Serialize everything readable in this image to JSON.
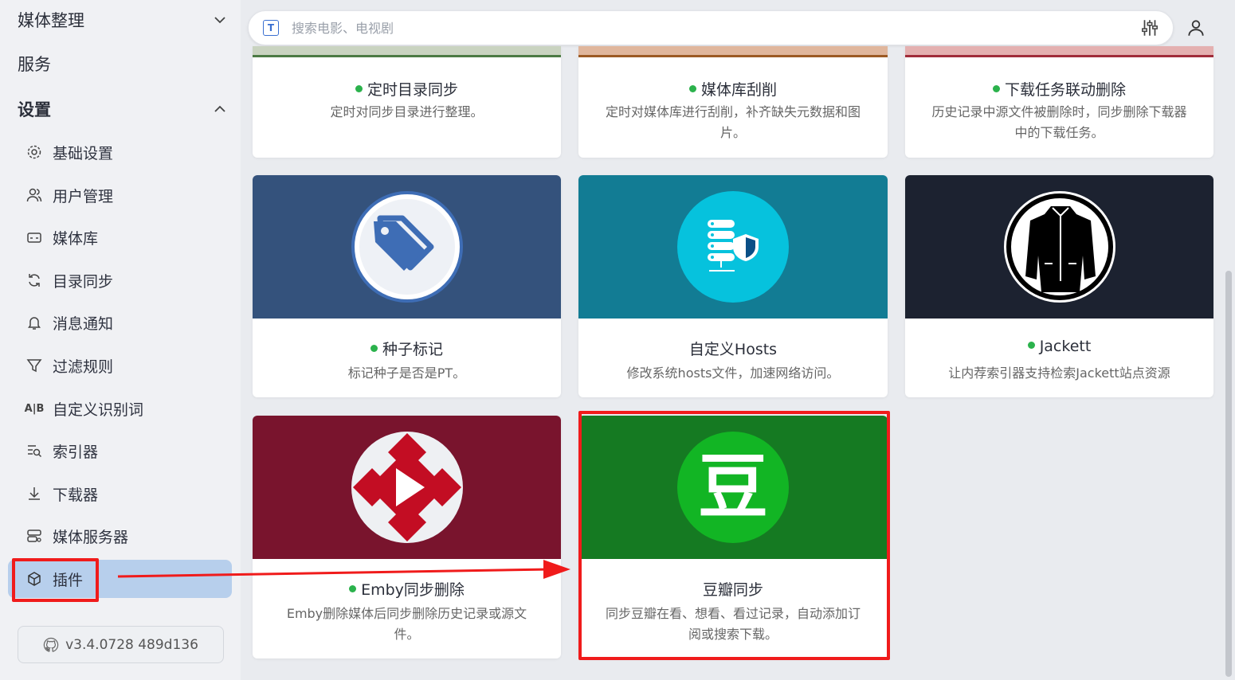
{
  "sidebar": {
    "groups": {
      "media_organize": "媒体整理",
      "services": "服务",
      "settings": "设置"
    },
    "items": [
      {
        "label": "基础设置",
        "icon": "gear-icon"
      },
      {
        "label": "用户管理",
        "icon": "users-icon"
      },
      {
        "label": "媒体库",
        "icon": "media-library-icon"
      },
      {
        "label": "目录同步",
        "icon": "sync-icon"
      },
      {
        "label": "消息通知",
        "icon": "bell-icon"
      },
      {
        "label": "过滤规则",
        "icon": "filter-icon"
      },
      {
        "label": "自定义识别词",
        "icon": "ab-icon"
      },
      {
        "label": "索引器",
        "icon": "indexer-icon"
      },
      {
        "label": "下载器",
        "icon": "download-icon"
      },
      {
        "label": "媒体服务器",
        "icon": "server-icon"
      },
      {
        "label": "插件",
        "icon": "cube-icon",
        "active": true
      }
    ],
    "version": "v3.4.0728 489d136"
  },
  "search": {
    "placeholder": "搜索电影、电视剧"
  },
  "plugins": {
    "row1": [
      {
        "title": "定时目录同步",
        "desc": "定时对同步目录进行整理。",
        "enabled": true
      },
      {
        "title": "媒体库刮削",
        "desc": "定时对媒体库进行刮削，补齐缺失元数据和图片。",
        "enabled": true
      },
      {
        "title": "下载任务联动删除",
        "desc": "历史记录中源文件被删除时，同步删除下载器中的下载任务。",
        "enabled": true
      }
    ],
    "row2": [
      {
        "title": "种子标记",
        "desc": "标记种子是否是PT。",
        "enabled": true,
        "banner_color": "#34527c",
        "icon": "tag-icon"
      },
      {
        "title": "自定义Hosts",
        "desc": "修改系统hosts文件，加速网络访问。",
        "enabled": false,
        "banner_color": "#127c94",
        "icon": "hosts-server-icon"
      },
      {
        "title": "Jackett",
        "desc": "让内荐索引器支持检索Jackett站点资源",
        "enabled": true,
        "banner_color": "#1c2230",
        "icon": "jacket-icon"
      }
    ],
    "row3": [
      {
        "title": "Emby同步删除",
        "desc": "Emby删除媒体后同步删除历史记录或源文件。",
        "enabled": true,
        "banner_color": "#79142d",
        "icon": "emby-icon"
      },
      {
        "title": "豆瓣同步",
        "desc": "同步豆瓣在看、想看、看过记录，自动添加订阅或搜索下载。",
        "enabled": false,
        "banner_color": "#157a22",
        "icon": "douban-icon",
        "icon_char": "豆"
      }
    ]
  },
  "colors": {
    "highlight_red": "#f01b1b",
    "active_bg": "#b7cfec",
    "status_green": "#2bb24c"
  }
}
